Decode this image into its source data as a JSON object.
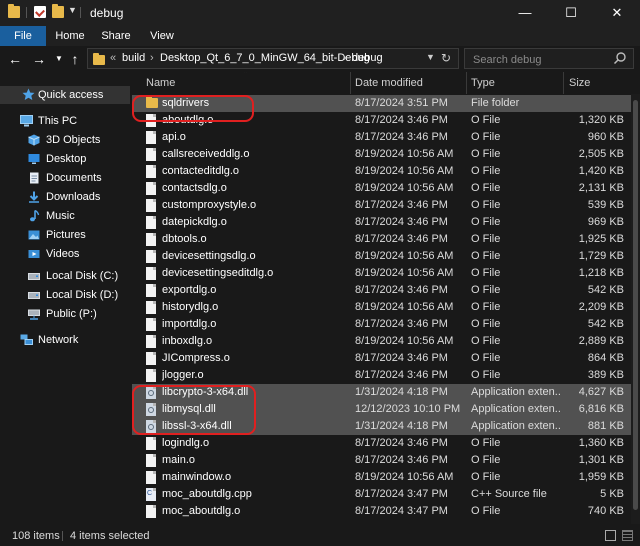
{
  "window": {
    "title": "debug",
    "minimize": "—",
    "maximize": "☐",
    "close": "✕"
  },
  "ribbon": {
    "tabs": [
      "File",
      "Home",
      "Share",
      "View"
    ]
  },
  "address": {
    "crumbs": [
      "build",
      "Desktop_Qt_6_7_0_MinGW_64_bit-Debug",
      "debug"
    ],
    "overflow": "«",
    "separator": "›"
  },
  "search": {
    "placeholder": "Search debug"
  },
  "nav_pane": {
    "items": [
      {
        "label": "Quick access",
        "icon": "star-icon",
        "selected": true
      },
      {
        "label": "This PC",
        "icon": "computer-icon"
      },
      {
        "label": "3D Objects",
        "icon": "cube-icon"
      },
      {
        "label": "Desktop",
        "icon": "desktop-icon"
      },
      {
        "label": "Documents",
        "icon": "document-icon"
      },
      {
        "label": "Downloads",
        "icon": "download-icon"
      },
      {
        "label": "Music",
        "icon": "music-icon"
      },
      {
        "label": "Pictures",
        "icon": "picture-icon"
      },
      {
        "label": "Videos",
        "icon": "video-icon"
      },
      {
        "label": "Local Disk (C:)",
        "icon": "drive-icon"
      },
      {
        "label": "Local Disk (D:)",
        "icon": "drive-icon"
      },
      {
        "label": "Public (P:)",
        "icon": "network-drive-icon"
      },
      {
        "label": "Network",
        "icon": "network-icon"
      }
    ]
  },
  "columns": {
    "name": "Name",
    "date": "Date modified",
    "type": "Type",
    "size": "Size"
  },
  "files": [
    {
      "name": "sqldrivers",
      "date": "8/17/2024 3:51 PM",
      "type": "File folder",
      "size": "",
      "kind": "folder",
      "selected": true
    },
    {
      "name": "aboutdlg.o",
      "date": "8/17/2024 3:46 PM",
      "type": "O File",
      "size": "1,320 KB",
      "kind": "file"
    },
    {
      "name": "api.o",
      "date": "8/17/2024 3:46 PM",
      "type": "O File",
      "size": "960 KB",
      "kind": "file"
    },
    {
      "name": "callsreceiveddlg.o",
      "date": "8/19/2024 10:56 AM",
      "type": "O File",
      "size": "2,505 KB",
      "kind": "file"
    },
    {
      "name": "contacteditdlg.o",
      "date": "8/19/2024 10:56 AM",
      "type": "O File",
      "size": "1,420 KB",
      "kind": "file"
    },
    {
      "name": "contactsdlg.o",
      "date": "8/19/2024 10:56 AM",
      "type": "O File",
      "size": "2,131 KB",
      "kind": "file"
    },
    {
      "name": "customproxystyle.o",
      "date": "8/17/2024 3:46 PM",
      "type": "O File",
      "size": "539 KB",
      "kind": "file"
    },
    {
      "name": "datepickdlg.o",
      "date": "8/17/2024 3:46 PM",
      "type": "O File",
      "size": "969 KB",
      "kind": "file"
    },
    {
      "name": "dbtools.o",
      "date": "8/17/2024 3:46 PM",
      "type": "O File",
      "size": "1,925 KB",
      "kind": "file"
    },
    {
      "name": "devicesettingsdlg.o",
      "date": "8/19/2024 10:56 AM",
      "type": "O File",
      "size": "1,729 KB",
      "kind": "file"
    },
    {
      "name": "devicesettingseditdlg.o",
      "date": "8/19/2024 10:56 AM",
      "type": "O File",
      "size": "1,218 KB",
      "kind": "file"
    },
    {
      "name": "exportdlg.o",
      "date": "8/17/2024 3:46 PM",
      "type": "O File",
      "size": "542 KB",
      "kind": "file"
    },
    {
      "name": "historydlg.o",
      "date": "8/19/2024 10:56 AM",
      "type": "O File",
      "size": "2,209 KB",
      "kind": "file"
    },
    {
      "name": "importdlg.o",
      "date": "8/17/2024 3:46 PM",
      "type": "O File",
      "size": "542 KB",
      "kind": "file"
    },
    {
      "name": "inboxdlg.o",
      "date": "8/19/2024 10:56 AM",
      "type": "O File",
      "size": "2,889 KB",
      "kind": "file"
    },
    {
      "name": "JICompress.o",
      "date": "8/17/2024 3:46 PM",
      "type": "O File",
      "size": "864 KB",
      "kind": "file"
    },
    {
      "name": "jlogger.o",
      "date": "8/17/2024 3:46 PM",
      "type": "O File",
      "size": "389 KB",
      "kind": "file"
    },
    {
      "name": "libcrypto-3-x64.dll",
      "date": "1/31/2024 4:18 PM",
      "type": "Application exten...",
      "size": "4,627 KB",
      "kind": "dll",
      "selected": true
    },
    {
      "name": "libmysql.dll",
      "date": "12/12/2023 10:10 PM",
      "type": "Application exten...",
      "size": "6,816 KB",
      "kind": "dll",
      "selected": true
    },
    {
      "name": "libssl-3-x64.dll",
      "date": "1/31/2024 4:18 PM",
      "type": "Application exten...",
      "size": "881 KB",
      "kind": "dll",
      "selected": true
    },
    {
      "name": "logindlg.o",
      "date": "8/17/2024 3:46 PM",
      "type": "O File",
      "size": "1,360 KB",
      "kind": "file"
    },
    {
      "name": "main.o",
      "date": "8/17/2024 3:46 PM",
      "type": "O File",
      "size": "1,301 KB",
      "kind": "file"
    },
    {
      "name": "mainwindow.o",
      "date": "8/19/2024 10:56 AM",
      "type": "O File",
      "size": "1,959 KB",
      "kind": "file"
    },
    {
      "name": "moc_aboutdlg.cpp",
      "date": "8/17/2024 3:47 PM",
      "type": "C++ Source file",
      "size": "5 KB",
      "kind": "cpp"
    },
    {
      "name": "moc_aboutdlg.o",
      "date": "8/17/2024 3:47 PM",
      "type": "O File",
      "size": "740 KB",
      "kind": "file"
    }
  ],
  "status": {
    "items": "108 items",
    "selected": "4 items selected"
  },
  "colors": {
    "background": "#191919",
    "selection": "#515151",
    "accent": "#1a5f9e",
    "highlight": "#e02020",
    "folder": "#e8b94a"
  }
}
